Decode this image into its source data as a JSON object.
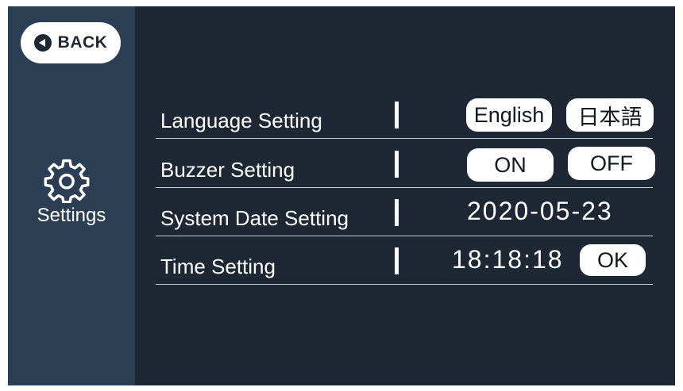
{
  "sidebar": {
    "back_label": "BACK",
    "settings_label": "Settings"
  },
  "settings": {
    "language": {
      "label": "Language Setting",
      "options": [
        "English",
        "日本語"
      ]
    },
    "buzzer": {
      "label": "Buzzer Setting",
      "options": [
        "ON",
        "OFF"
      ]
    },
    "date": {
      "label": "System Date Setting",
      "value": "2020-05-23"
    },
    "time": {
      "label": "Time Setting",
      "value": "18:18:18",
      "ok_label": "OK"
    }
  },
  "colors": {
    "screen_bg": "#1e2835",
    "sidebar_bg": "#2c3e54",
    "button_bg": "#ffffff",
    "text": "#ffffff"
  }
}
